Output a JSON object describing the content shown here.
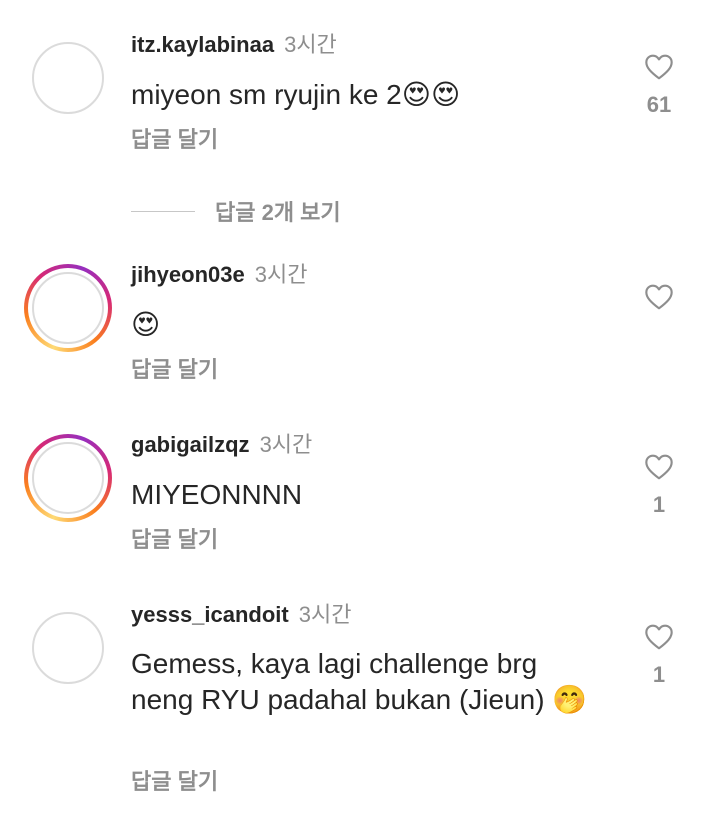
{
  "comments": [
    {
      "username": "itz.kaylabinaa",
      "time": "3시간",
      "text": "miyeon sm ryujin ke 2😍😍",
      "reply_label": "답글 달기",
      "likes": "61",
      "story_ring": false
    },
    {
      "username": "jihyeon03e",
      "time": "3시간",
      "text": "😍",
      "reply_label": "답글 달기",
      "likes": "",
      "story_ring": true
    },
    {
      "username": "gabigailzqz",
      "time": "3시간",
      "text": "MIYEONNNN",
      "reply_label": "답글 달기",
      "likes": "1",
      "story_ring": true
    },
    {
      "username": "yesss_icandoit",
      "time": "3시간",
      "text": "Gemess, kaya lagi challenge brg neng RYU padahal bukan (Jieun) 🤭",
      "reply_label": "답글 달기",
      "likes": "1",
      "story_ring": false
    }
  ],
  "view_replies_label": "답글 2개 보기",
  "icons": {
    "like": "heart-outline-icon"
  },
  "colors": {
    "secondary_text": "#8e8e8e",
    "primary_text": "#262626",
    "story_ring_start": "#feda75",
    "story_ring_end": "#d62976"
  }
}
